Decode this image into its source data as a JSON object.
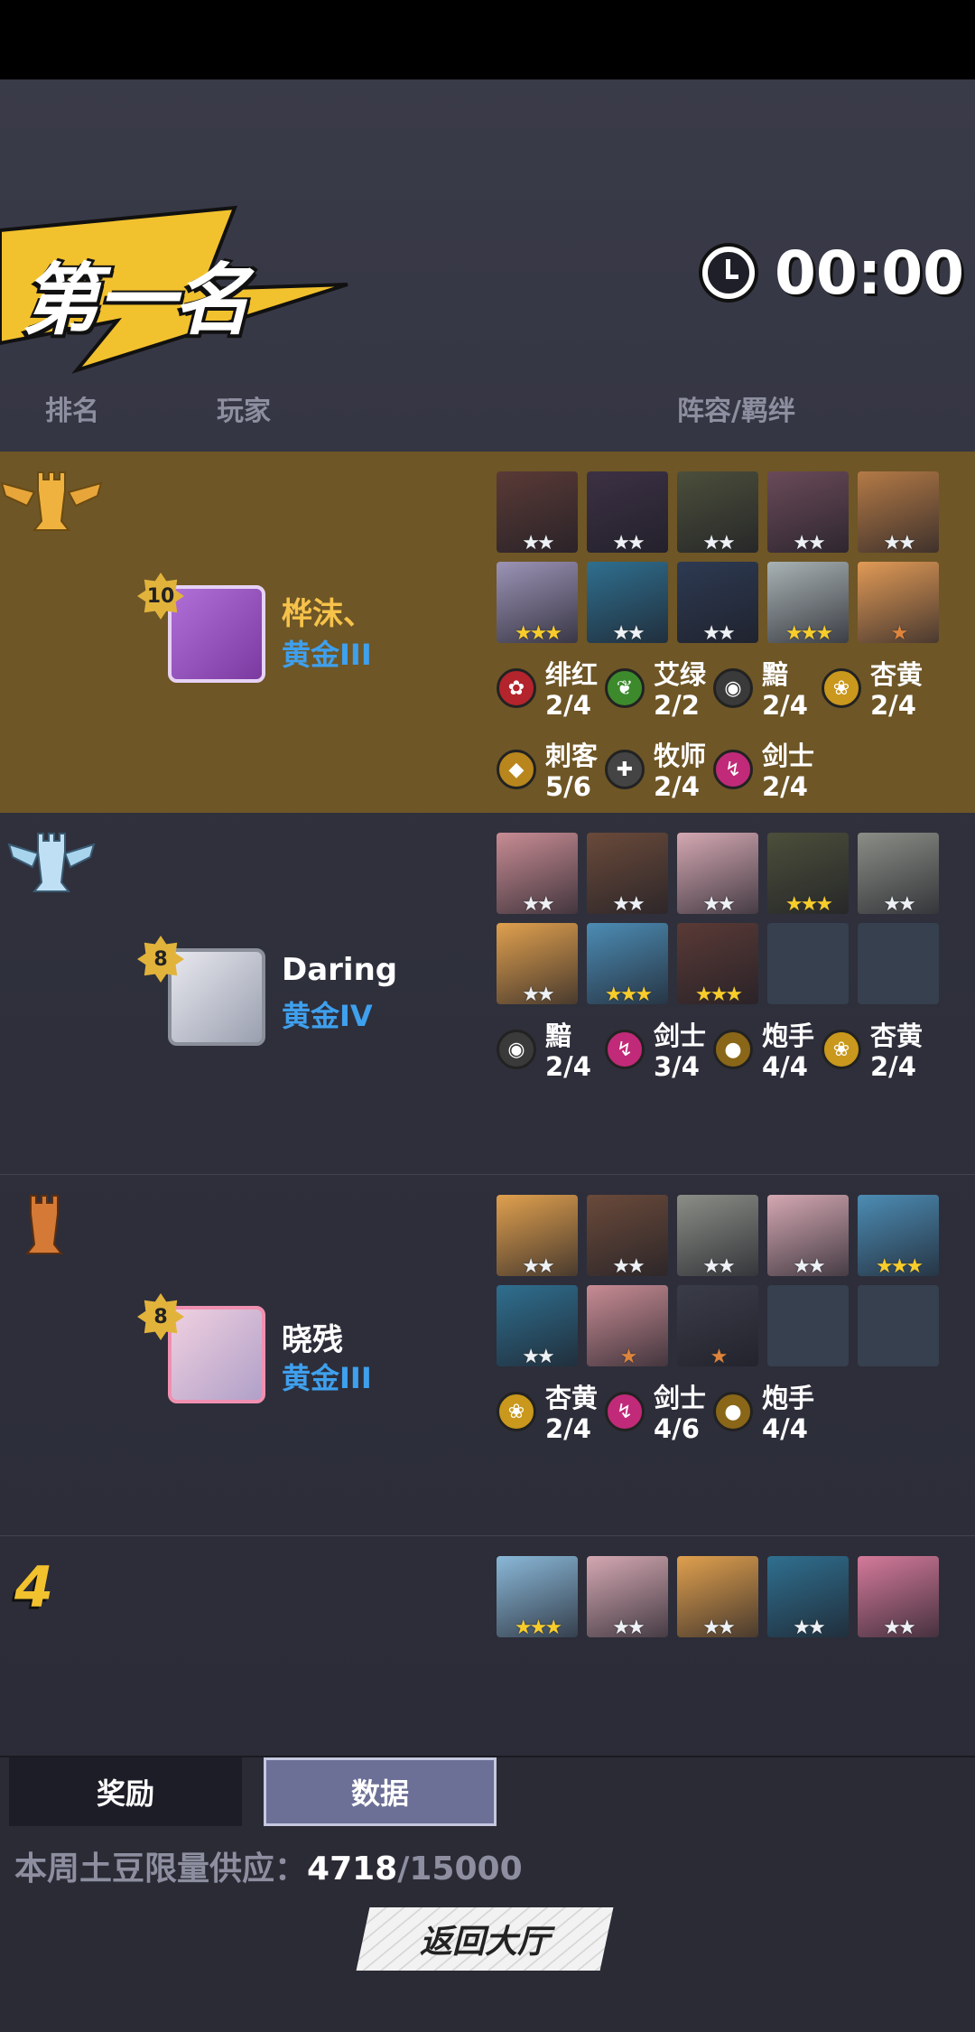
{
  "header": {
    "title": "第一名",
    "timer": "00:00"
  },
  "columns": {
    "rank": "排名",
    "player": "玩家",
    "lineup": "阵容/羁绊"
  },
  "rows": [
    {
      "rank_badge": "gold-winged-rook-icon",
      "level": "10",
      "name": "桦沫、",
      "tier": "黄金III",
      "units": [
        {
          "color": "#5a3a36",
          "stars": 2,
          "star_type": "white"
        },
        {
          "color": "#3c3144",
          "stars": 2,
          "star_type": "white"
        },
        {
          "color": "#4b4f3a",
          "stars": 2,
          "star_type": "white"
        },
        {
          "color": "#6a4a58",
          "stars": 2,
          "star_type": "white"
        },
        {
          "color": "#b47a46",
          "stars": 2,
          "star_type": "white"
        },
        {
          "color": "#9c93b6",
          "stars": 3,
          "star_type": "gold"
        },
        {
          "color": "#2f6f8f",
          "stars": 2,
          "star_type": "white"
        },
        {
          "color": "#2d3a52",
          "stars": 2,
          "star_type": "white"
        },
        {
          "color": "#a8b2b4",
          "stars": 3,
          "star_type": "gold"
        },
        {
          "color": "#e19a56",
          "stars": 1,
          "star_type": "bronze"
        }
      ],
      "synergies": [
        {
          "name": "绯红",
          "count": "2/4",
          "icon": "crimson-rose-icon",
          "color": "#b4242c"
        },
        {
          "name": "艾绿",
          "count": "2/2",
          "icon": "green-leaf-icon",
          "color": "#3c8a2c"
        },
        {
          "name": "黯",
          "count": "2/4",
          "icon": "dark-eye-icon",
          "color": "#3a3a3a"
        },
        {
          "name": "杏黄",
          "count": "2/4",
          "icon": "yellow-lotus-icon",
          "color": "#c9981c"
        },
        {
          "name": "刺客",
          "count": "5/6",
          "icon": "assassin-icon",
          "color": "#b8861c"
        },
        {
          "name": "牧师",
          "count": "2/4",
          "icon": "priest-cross-icon",
          "color": "#444"
        },
        {
          "name": "剑士",
          "count": "2/4",
          "icon": "swordsman-icon",
          "color": "#c02a78"
        }
      ]
    },
    {
      "rank_badge": "silver-winged-rook-icon",
      "level": "8",
      "name": "Daring",
      "tier": "黄金IV",
      "units": [
        {
          "color": "#c88c94",
          "stars": 2,
          "star_type": "white"
        },
        {
          "color": "#6a4a3a",
          "stars": 2,
          "star_type": "white"
        },
        {
          "color": "#d4a8b2",
          "stars": 2,
          "star_type": "white"
        },
        {
          "color": "#4b4f3a",
          "stars": 3,
          "star_type": "gold"
        },
        {
          "color": "#8a8e86",
          "stars": 2,
          "star_type": "white"
        },
        {
          "color": "#e0a04e",
          "stars": 2,
          "star_type": "white"
        },
        {
          "color": "#4c8cb4",
          "stars": 3,
          "star_type": "gold"
        },
        {
          "color": "#5a3a36",
          "stars": 3,
          "star_type": "gold"
        },
        {
          "color": "",
          "stars": 0,
          "star_type": "empty"
        },
        {
          "color": "",
          "stars": 0,
          "star_type": "empty"
        }
      ],
      "synergies": [
        {
          "name": "黯",
          "count": "2/4",
          "icon": "dark-eye-icon",
          "color": "#3a3a3a"
        },
        {
          "name": "剑士",
          "count": "3/4",
          "icon": "swordsman-icon",
          "color": "#c02a78"
        },
        {
          "name": "炮手",
          "count": "4/4",
          "icon": "gunner-icon",
          "color": "#8a6618"
        },
        {
          "name": "杏黄",
          "count": "2/4",
          "icon": "yellow-lotus-icon",
          "color": "#c9981c"
        }
      ]
    },
    {
      "rank_badge": "bronze-rook-icon",
      "level": "8",
      "name": "晓残",
      "tier": "黄金III",
      "units": [
        {
          "color": "#e0a04e",
          "stars": 2,
          "star_type": "white"
        },
        {
          "color": "#6a4a3a",
          "stars": 2,
          "star_type": "white"
        },
        {
          "color": "#8a8e86",
          "stars": 2,
          "star_type": "white"
        },
        {
          "color": "#d4a8b2",
          "stars": 2,
          "star_type": "white"
        },
        {
          "color": "#4c8cb4",
          "stars": 3,
          "star_type": "gold"
        },
        {
          "color": "#2f6f8f",
          "stars": 2,
          "star_type": "white"
        },
        {
          "color": "#c88c94",
          "stars": 1,
          "star_type": "bronze"
        },
        {
          "color": "#3a3c48",
          "stars": 1,
          "star_type": "bronze"
        },
        {
          "color": "",
          "stars": 0,
          "star_type": "empty"
        },
        {
          "color": "",
          "stars": 0,
          "star_type": "empty"
        }
      ],
      "synergies": [
        {
          "name": "杏黄",
          "count": "2/4",
          "icon": "yellow-lotus-icon",
          "color": "#c9981c"
        },
        {
          "name": "剑士",
          "count": "4/6",
          "icon": "swordsman-icon",
          "color": "#c02a78"
        },
        {
          "name": "炮手",
          "count": "4/4",
          "icon": "gunner-icon",
          "color": "#8a6618"
        }
      ]
    },
    {
      "rank_badge": "4",
      "units": [
        {
          "color": "#8ab8d8",
          "stars": 3,
          "star_type": "gold"
        },
        {
          "color": "#d4a8b2",
          "stars": 2,
          "star_type": "white"
        },
        {
          "color": "#e0a04e",
          "stars": 2,
          "star_type": "white"
        },
        {
          "color": "#2f6f8f",
          "stars": 2,
          "star_type": "white"
        },
        {
          "color": "#d47a9a",
          "stars": 2,
          "star_type": "white"
        }
      ]
    }
  ],
  "tabs": {
    "reward": "奖励",
    "data": "数据"
  },
  "supply": {
    "label": "本周土豆限量供应：",
    "current": "4718",
    "max": "/15000"
  },
  "back_button": "返回大厅"
}
